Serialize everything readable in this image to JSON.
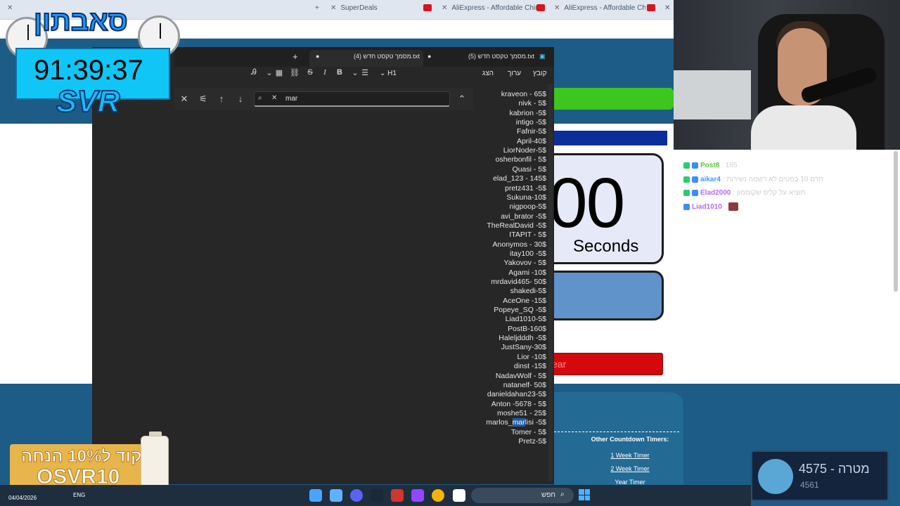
{
  "browser": {
    "tabs": [
      {
        "title": "SuperDeals"
      },
      {
        "title": "AliExpress - Affordable Chinese"
      },
      {
        "title": "AliExpress - Affordable Chinese"
      }
    ]
  },
  "stream_overlay": {
    "logo_text": "סאבתון",
    "timer": "91:39:37",
    "brand": "SVR",
    "promo_line1": "קוד ל10% הנחה",
    "promo_line2": "OSVR10",
    "goal_label": "4575 - מטרה",
    "goal_sub": "4561"
  },
  "countdown_site": {
    "big_digits": "00",
    "seconds_label": "Seconds",
    "red_button_partial": "ear",
    "other_timers_title": "Other Countdown Timers:",
    "links": [
      "1 Week Timer",
      "2 Week Timer",
      "Year Timer"
    ]
  },
  "chat": [
    {
      "user": "Post8",
      "text": ": 165",
      "color": "#58c938"
    },
    {
      "user": "aikar4",
      "text": ": תרם 10 בפטים לא רשמה נשירות",
      "color": "#3aa0ff"
    },
    {
      "user": "Elad2000",
      "text": ": תוציא על קליפ שקוממון",
      "color": "#b46bff"
    },
    {
      "user": "Liad1010",
      "text": ":",
      "color": "#b46bff"
    }
  ],
  "notepad": {
    "tabs": [
      "מסמך טקסט חדש (5).txt",
      "מסמך טקסט חדש (4).txt"
    ],
    "menu": [
      "קובץ",
      "ערוך",
      "הצג"
    ],
    "heading_btn": "H1",
    "find_value": "mar",
    "lines": [
      "kraveon - 65$",
      "nivk - 5$",
      "kabrion -5$",
      "intigo -5$",
      "Fafnir-5$",
      "April-40$",
      "LiorNoder-5$",
      "osherbonfil - 5$",
      "Quasi - 5$",
      "elad_123 - 145$",
      "pretz431 -5$",
      "Sukuna-10$",
      "nigpoop-5$",
      "avi_brator -5$",
      "TheRealDavid -5$",
      "ITAPIT - 5$",
      "Anonymos - 30$",
      "itay100 -5$",
      "Yakovov - 5$",
      "Agami -10$",
      "mrdavid465- 50$",
      "shakedi-5$",
      "AceOne -15$",
      "Popeye_SQ -5$",
      "Liad1010-5$",
      "PostB-160$",
      "Haleljdddh -5$",
      "JustSany-30$",
      "Lior -10$",
      "dinst -15$",
      "NadavWolf - 5$",
      "natanelf- 50$",
      "danieldahan23-5$",
      "Anton -5678 - 5$",
      "moshe51 - 25$",
      "marlos_marlisi -5$",
      "Tomer - 5$",
      "Pretz-5$"
    ],
    "highlight_line_prefix": "marlos_",
    "highlight_text": "mar",
    "highlight_suffix": "lisi -5$"
  },
  "taskbar": {
    "date": "04/04/2026",
    "lang": "ENG",
    "search_label": "חפש"
  }
}
